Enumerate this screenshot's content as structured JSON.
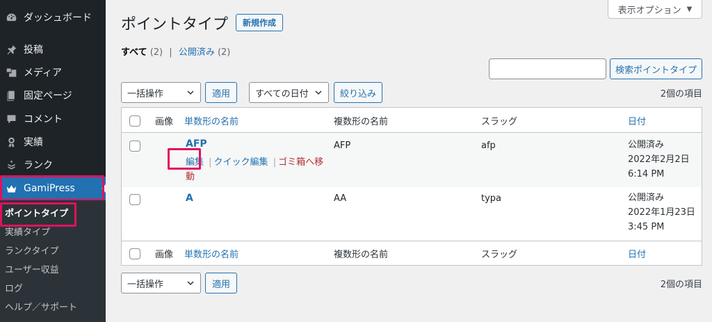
{
  "sidebar": {
    "items": [
      {
        "label": "ダッシュボード",
        "icon": "dashboard-icon"
      },
      {
        "label": "投稿",
        "icon": "pin-icon"
      },
      {
        "label": "メディア",
        "icon": "media-icon"
      },
      {
        "label": "固定ページ",
        "icon": "page-icon"
      },
      {
        "label": "コメント",
        "icon": "comment-icon"
      },
      {
        "label": "実績",
        "icon": "award-icon"
      },
      {
        "label": "ランク",
        "icon": "rank-icon"
      },
      {
        "label": "GamiPress",
        "icon": "crown-icon"
      }
    ],
    "submenu": [
      "ポイントタイプ",
      "実績タイプ",
      "ランクタイプ",
      "ユーザー収益",
      "ログ",
      "ヘルプ／サポート"
    ]
  },
  "header": {
    "title": "ポイントタイプ",
    "add_new": "新規作成",
    "screen_options": "表示オプション"
  },
  "filters": {
    "all_label": "すべて",
    "all_count": "(2)",
    "sep": "|",
    "published_label": "公開済み",
    "published_count": "(2)"
  },
  "search": {
    "value": "",
    "button": "検索ポイントタイプ"
  },
  "bulk": {
    "select": "一括操作",
    "apply": "適用",
    "date_select": "すべての日付",
    "filter": "絞り込み",
    "count": "2個の項目"
  },
  "table": {
    "columns": {
      "image": "画像",
      "singular": "単数形の名前",
      "plural": "複数形の名前",
      "slug": "スラッグ",
      "date": "日付"
    },
    "rows": [
      {
        "singular": "AFP",
        "plural": "AFP",
        "slug": "afp",
        "status": "公開済み",
        "date": "2022年2月2日",
        "time": "6:14 PM",
        "actions": {
          "edit": "編集",
          "sep": "|",
          "quick_edit": "クイック編集",
          "trash_1": "ゴミ箱へ移",
          "trash_2": "動"
        }
      },
      {
        "singular": "A",
        "plural": "AA",
        "slug": "typa",
        "status": "公開済み",
        "date": "2022年1月23日",
        "time": "3:45 PM"
      }
    ]
  },
  "colors": {
    "sidebar_bg": "#1d2327",
    "accent": "#2271b1",
    "highlight": "#e0115f",
    "trash": "#b32d2e"
  }
}
